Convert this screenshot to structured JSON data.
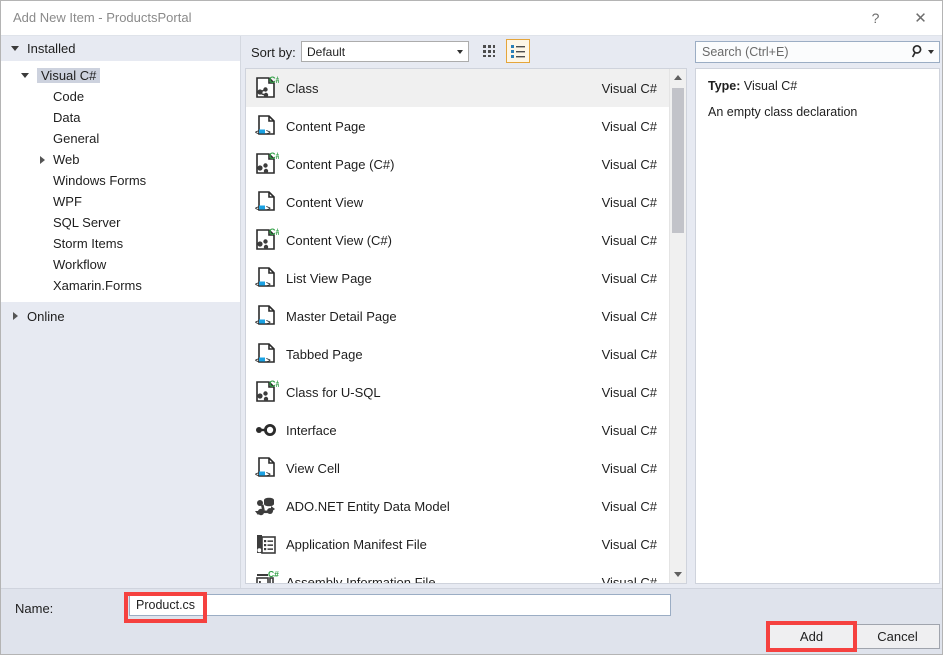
{
  "window": {
    "title": "Add New Item - ProductsPortal",
    "help_glyph": "?",
    "close_glyph": "✕"
  },
  "sidebar": {
    "groups": [
      {
        "label": "Installed",
        "expanded": true
      },
      {
        "label": "Online",
        "expanded": false
      }
    ],
    "tree": [
      {
        "label": "Visual C#",
        "level": 1,
        "twisty": "down",
        "selected": true
      },
      {
        "label": "Code",
        "level": 2,
        "twisty": "none",
        "selected": false
      },
      {
        "label": "Data",
        "level": 2,
        "twisty": "none",
        "selected": false
      },
      {
        "label": "General",
        "level": 2,
        "twisty": "none",
        "selected": false
      },
      {
        "label": "Web",
        "level": 2,
        "twisty": "right",
        "selected": false
      },
      {
        "label": "Windows Forms",
        "level": 2,
        "twisty": "none",
        "selected": false
      },
      {
        "label": "WPF",
        "level": 2,
        "twisty": "none",
        "selected": false
      },
      {
        "label": "SQL Server",
        "level": 2,
        "twisty": "none",
        "selected": false
      },
      {
        "label": "Storm Items",
        "level": 2,
        "twisty": "none",
        "selected": false
      },
      {
        "label": "Workflow",
        "level": 2,
        "twisty": "none",
        "selected": false
      },
      {
        "label": "Xamarin.Forms",
        "level": 2,
        "twisty": "none",
        "selected": false
      }
    ]
  },
  "toolbar": {
    "sort_by_label": "Sort by:",
    "sort_value": "Default",
    "tiles_view_icon": "tiles-view-icon",
    "list_view_icon": "list-view-icon",
    "list_view_active": true
  },
  "search": {
    "placeholder": "Search (Ctrl+E)",
    "icon": "search-icon"
  },
  "list": {
    "items": [
      {
        "name": "Class",
        "lang": "Visual C#",
        "icon": "csharp-class-icon",
        "selected": true
      },
      {
        "name": "Content Page",
        "lang": "Visual C#",
        "icon": "xaml-page-icon",
        "selected": false
      },
      {
        "name": "Content Page (C#)",
        "lang": "Visual C#",
        "icon": "csharp-class-icon",
        "selected": false
      },
      {
        "name": "Content View",
        "lang": "Visual C#",
        "icon": "xaml-page-icon",
        "selected": false
      },
      {
        "name": "Content View (C#)",
        "lang": "Visual C#",
        "icon": "csharp-class-icon",
        "selected": false
      },
      {
        "name": "List View Page",
        "lang": "Visual C#",
        "icon": "xaml-page-icon",
        "selected": false
      },
      {
        "name": "Master Detail Page",
        "lang": "Visual C#",
        "icon": "xaml-page-icon",
        "selected": false
      },
      {
        "name": "Tabbed Page",
        "lang": "Visual C#",
        "icon": "xaml-page-icon",
        "selected": false
      },
      {
        "name": "Class for U-SQL",
        "lang": "Visual C#",
        "icon": "csharp-class-icon",
        "selected": false
      },
      {
        "name": "Interface",
        "lang": "Visual C#",
        "icon": "interface-icon",
        "selected": false
      },
      {
        "name": "View Cell",
        "lang": "Visual C#",
        "icon": "xaml-page-icon",
        "selected": false
      },
      {
        "name": "ADO.NET Entity Data Model",
        "lang": "Visual C#",
        "icon": "entity-data-model-icon",
        "selected": false
      },
      {
        "name": "Application Manifest File",
        "lang": "Visual C#",
        "icon": "manifest-file-icon",
        "selected": false
      },
      {
        "name": "Assembly Information File",
        "lang": "Visual C#",
        "icon": "assembly-info-icon",
        "selected": false
      }
    ],
    "scrollbar": {
      "up_icon": "scroll-up-icon",
      "down_icon": "scroll-down-icon"
    }
  },
  "details": {
    "type_key": "Type:",
    "type_value": "Visual C#",
    "description": "An empty class declaration"
  },
  "footer": {
    "name_label": "Name:",
    "name_value": "Product.cs",
    "add_label": "Add",
    "cancel_label": "Cancel"
  },
  "annotations": {
    "highlight_color": "#f5413f",
    "boxes": [
      "name-field-highlight",
      "add-button-highlight"
    ]
  }
}
